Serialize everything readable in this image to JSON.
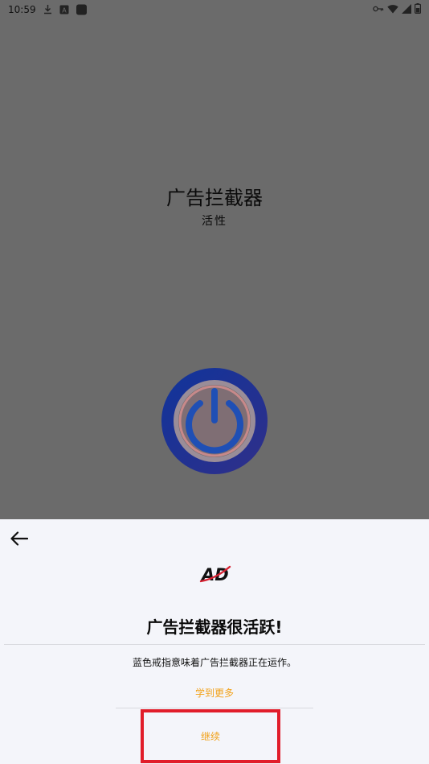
{
  "status_bar": {
    "time": "10:59",
    "left_icons": [
      "download-icon",
      "a-box-icon",
      "app-square-icon"
    ],
    "right_icons": [
      "key-icon",
      "wifi-icon",
      "signal-icon",
      "battery-icon"
    ]
  },
  "main": {
    "title": "广告拦截器",
    "subtitle": "活性",
    "power_icon": "power-icon"
  },
  "sheet": {
    "back_icon": "back-arrow-icon",
    "logo_text": "AD",
    "heading": "广告拦截器很活跃!",
    "description": "蓝色戒指意味着广告拦截器正在运作。",
    "learn_more_label": "学到更多",
    "continue_label": "继续"
  },
  "colors": {
    "overlay_bg": "#6b6b6b",
    "sheet_bg": "#f4f5fa",
    "accent_orange": "#f2a21a",
    "highlight_red": "#e11d2a",
    "power_ring_outer": "#2b2f86",
    "power_ring_blue": "#1f4fb5"
  }
}
